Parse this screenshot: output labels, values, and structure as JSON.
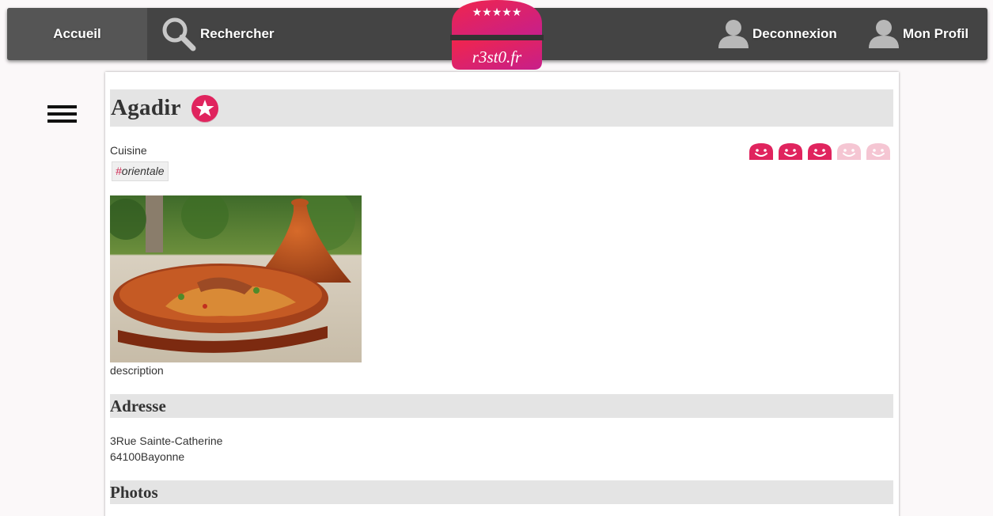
{
  "nav": {
    "home_label": "Accueil",
    "search_label": "Rechercher",
    "logout_label": "Deconnexion",
    "profile_label": "Mon Profil"
  },
  "logo": {
    "text": "r3st0.fr",
    "stars": "★★★★★"
  },
  "restaurant": {
    "name": "Agadir",
    "cuisine_label": "Cuisine",
    "tag_hash": "#",
    "tag": "orientale",
    "rating": 3,
    "rating_max": 5,
    "description": "description"
  },
  "address": {
    "heading": "Adresse",
    "street_number": "3",
    "street": "Rue Sainte-Catherine",
    "postal_code": "64100",
    "city": "Bayonne",
    "line1": "3Rue Sainte-Catherine",
    "line2": "64100Bayonne"
  },
  "photos": {
    "heading": "Photos"
  },
  "colors": {
    "nav_bg": "#444444",
    "accent": "#e0245e",
    "accent_light": "#f5c6d3",
    "section_bg": "#e4e4e4"
  },
  "icons": {
    "search": "search-icon",
    "user": "user-icon",
    "favorite": "star-icon",
    "menu": "hamburger-icon",
    "rating": "smiley-icon"
  }
}
